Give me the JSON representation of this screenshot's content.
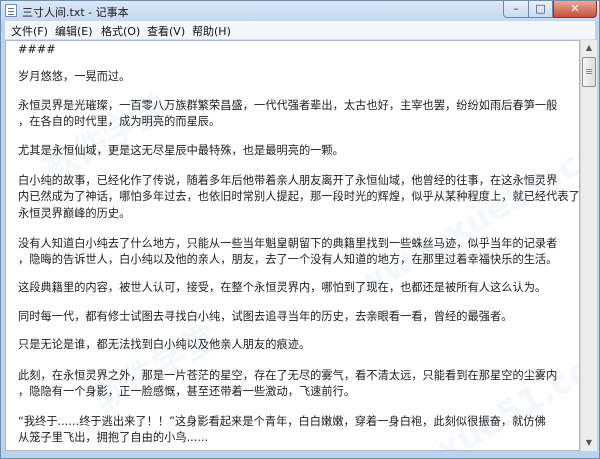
{
  "window": {
    "title": "三寸人间.txt - 记事本",
    "caption_buttons": {
      "minimize": "–",
      "maximize": "□",
      "close": "✕"
    }
  },
  "menu": {
    "items": [
      "文件(F)",
      "编辑(E)",
      "格式(O)",
      "查看(V)",
      "帮助(H)"
    ]
  },
  "document": {
    "lines": [
      "####",
      "",
      "岁月悠悠，一晃而过。",
      "",
      "永恒灵界是光璀璨，一百零八万族群繁荣昌盛，一代代强者辈出，太古也好，主宰也罢，纷纷如雨后春笋一般",
      "，在各自的时代里，成为明亮的而星辰。",
      "",
      "尤其是永恒仙域，更是这无尽星辰中最特殊，也是最明亮的一颗。",
      "",
      "白小纯的故事，已经化作了传说，随着多年后他带着亲人朋友离开了永恒仙域，他曾经的往事，在这永恒灵界",
      "内已然成为了神话，哪怕多年过去，也依旧时常别人提起，那一段时光的辉煌，似乎从某种程度上，就已经代表了",
      "永恒灵界巅峰的历史。",
      "",
      "没有人知道白小纯去了什么地方，只能从一些当年魁皇朝留下的典籍里找到一些蛛丝马迹，似乎当年的记录者",
      "，隐晦的告诉世人，白小纯以及他的亲人，朋友，去了一个没有人知道的地方，在那里过着幸福快乐的生活。",
      "",
      "这段典籍里的内容，被世人认可，接受，在整个永恒灵界内，哪怕到了现在，也都还是被所有人这么认为。",
      "",
      "同时每一代，都有修士试图去寻找白小纯，试图去追寻当年的历史，去亲眼看一看，曾经的最强者。",
      "",
      "只是无论是谁，都无法找到白小纯以及他亲人朋友的痕迹。",
      "",
      "此刻，在永恒灵界之外，那是一片苍茫的星空，存在了无尽的雾气，看不清太远，只能看到在那星空的尘雾内",
      "，隐隐有一个身影，正一脸感慨，甚至还带着一些激动，飞速前行。",
      "",
      "“我终于......终于逃出来了！！”这身影看起来是个青年，白白嫩嫩，穿着一身白袍，此刻似很振奋，就仿佛",
      "从笼子里飞出，拥抱了自由的小鸟......"
    ]
  },
  "watermarks": [
    "软件学堂",
    "www.xue51.com",
    "软件学堂",
    "xue51.com"
  ],
  "scrollbar": {
    "up_arrow": "▲",
    "down_arrow": "▼"
  }
}
